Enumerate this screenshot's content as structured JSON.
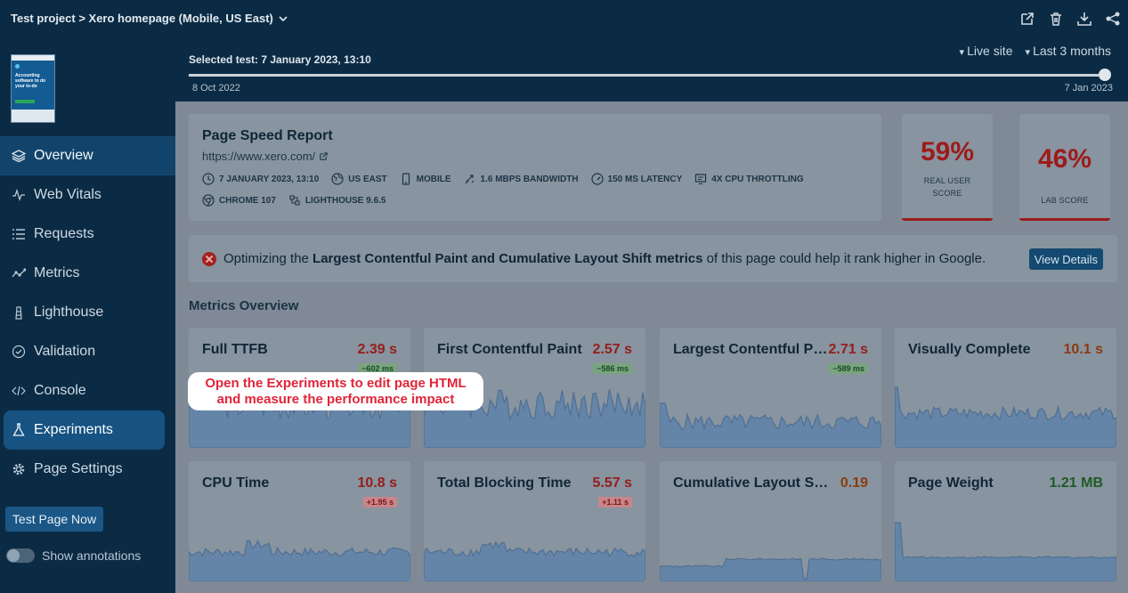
{
  "header": {
    "breadcrumb": "Test project > Xero homepage (Mobile, US East)",
    "icons": [
      "external-link-icon",
      "trash-icon",
      "download-icon",
      "share-icon"
    ]
  },
  "thumbnail": {
    "text": "Accounting software to do your to-do"
  },
  "sidebar": {
    "items": [
      {
        "label": "Overview",
        "icon": "layers-icon"
      },
      {
        "label": "Web Vitals",
        "icon": "pulse-icon"
      },
      {
        "label": "Requests",
        "icon": "list-icon"
      },
      {
        "label": "Metrics",
        "icon": "trend-icon"
      },
      {
        "label": "Lighthouse",
        "icon": "lighthouse-icon"
      },
      {
        "label": "Validation",
        "icon": "check-circle-icon"
      },
      {
        "label": "Console",
        "icon": "code-icon"
      },
      {
        "label": "Experiments",
        "icon": "flask-icon"
      },
      {
        "label": "Page Settings",
        "icon": "gear-icon"
      }
    ],
    "test_button": "Test Page Now",
    "annotations_toggle": "Show annotations"
  },
  "timeline": {
    "selected": "Selected test: 7 January 2023, 13:10",
    "filter_site": "Live site",
    "filter_range": "Last 3 months",
    "start_date": "8 Oct 2022",
    "end_date": "7 Jan 2023"
  },
  "report": {
    "title": "Page Speed Report",
    "url": "https://www.xero.com/",
    "meta_row1": [
      "7 JANUARY 2023, 13:10",
      "US EAST",
      "MOBILE",
      "1.6 MBPS BANDWIDTH",
      "150 MS LATENCY",
      "4X CPU THROTTLING"
    ],
    "meta_row2": [
      "CHROME 107",
      "LIGHTHOUSE 9.6.5"
    ]
  },
  "scores": [
    {
      "value": "59%",
      "label": "REAL USER SCORE"
    },
    {
      "value": "46%",
      "label": "LAB SCORE"
    }
  ],
  "alert": {
    "pre": "Optimizing the ",
    "bold": "Largest Contentful Paint and Cumulative Layout Shift metrics",
    "post": " of this page could help it rank higher in Google.",
    "button": "View Details"
  },
  "metrics_title": "Metrics Overview",
  "metrics": [
    {
      "name": "Full TTFB",
      "value": "2.39 s",
      "delta": "−602 ms",
      "delta_type": "good",
      "color": "red"
    },
    {
      "name": "First Contentful Paint",
      "value": "2.57 s",
      "delta": "−586 ms",
      "delta_type": "good",
      "color": "red"
    },
    {
      "name": "Largest Contentful Pa...",
      "value": "2.71 s",
      "delta": "−589 ms",
      "delta_type": "good",
      "color": "red"
    },
    {
      "name": "Visually Complete",
      "value": "10.1 s",
      "delta": "",
      "delta_type": "",
      "color": "orange"
    },
    {
      "name": "CPU Time",
      "value": "10.8 s",
      "delta": "+1.95 s",
      "delta_type": "bad",
      "color": "red"
    },
    {
      "name": "Total Blocking Time",
      "value": "5.57 s",
      "delta": "+1.11 s",
      "delta_type": "bad",
      "color": "red"
    },
    {
      "name": "Cumulative Layout Shift",
      "value": "0.19",
      "delta": "",
      "delta_type": "",
      "color": "orange"
    },
    {
      "name": "Page Weight",
      "value": "1.21 MB",
      "delta": "",
      "delta_type": "",
      "color": "green"
    }
  ],
  "tooltip": {
    "line1": "Open the Experiments to edit page HTML",
    "line2": "and measure the performance impact"
  }
}
